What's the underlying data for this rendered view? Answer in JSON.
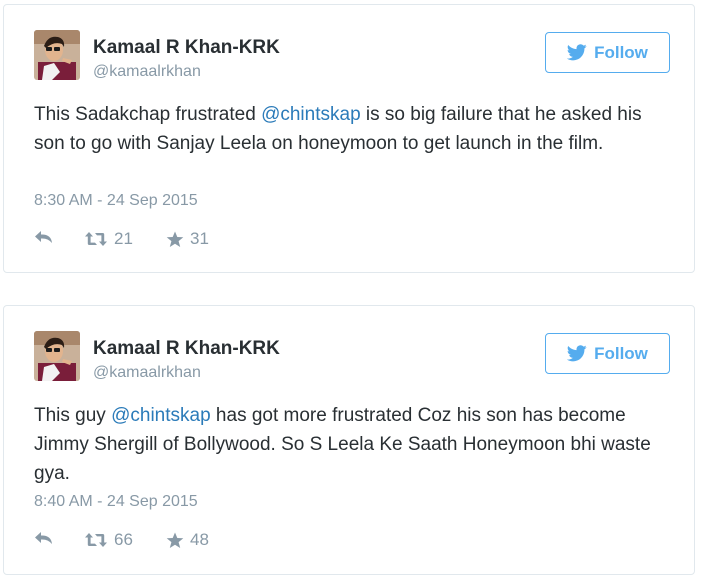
{
  "colors": {
    "link": "#2b7bb9",
    "twitter_blue": "#55acee",
    "muted": "#8899a6",
    "text": "#292f33",
    "border": "#e1e8ed"
  },
  "tweets": [
    {
      "author": {
        "name": "Kamaal R Khan-KRK",
        "handle": "@kamaalrkhan",
        "avatar_icon": "profile-photo"
      },
      "follow_label": "Follow",
      "text": {
        "before": "This Sadakchap frustrated ",
        "mention": "@chintskap",
        "after": " is so big failure that he asked his son to go with Sanjay Leela on honeymoon to get launch in the film."
      },
      "timestamp": "8:30 AM - 24 Sep 2015",
      "retweets": "21",
      "likes": "31"
    },
    {
      "author": {
        "name": "Kamaal R Khan-KRK",
        "handle": "@kamaalrkhan",
        "avatar_icon": "profile-photo"
      },
      "follow_label": "Follow",
      "text": {
        "before": "This guy ",
        "mention": "@chintskap",
        "after": " has got more frustrated Coz his son has become Jimmy Shergill of Bollywood. So S Leela Ke Saath Honeymoon bhi waste gya."
      },
      "timestamp": "8:40 AM - 24 Sep 2015",
      "retweets": "66",
      "likes": "48"
    }
  ]
}
